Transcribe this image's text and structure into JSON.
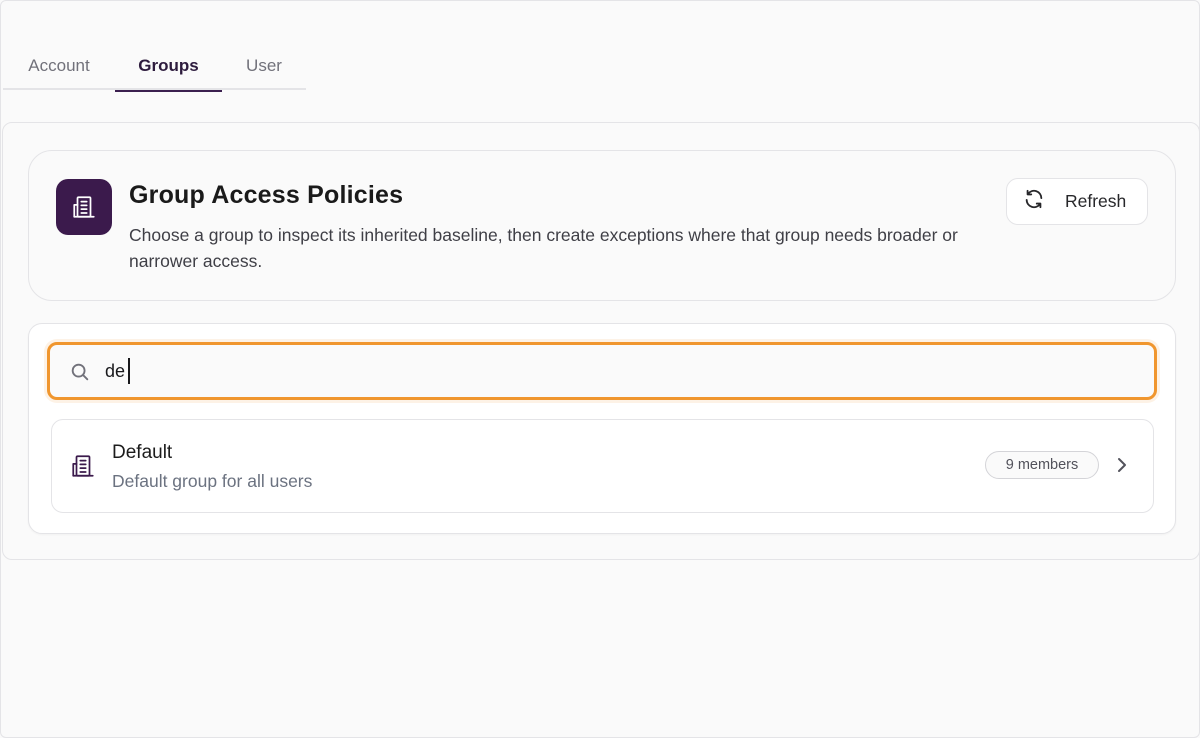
{
  "tabs": [
    {
      "label": "Account",
      "active": false
    },
    {
      "label": "Groups",
      "active": true
    },
    {
      "label": "User",
      "active": false
    }
  ],
  "header": {
    "title": "Group Access Policies",
    "description": "Choose a group to inspect its inherited baseline, then create exceptions where that group needs broader or narrower access.",
    "icon": "building-icon",
    "refresh_label": "Refresh"
  },
  "search": {
    "value": "de",
    "placeholder": ""
  },
  "groups": [
    {
      "name": "Default",
      "description": "Default group for all users",
      "members": "9 members"
    }
  ],
  "colors": {
    "accent": "#3b1a4c",
    "focus_ring": "#f0962e"
  }
}
